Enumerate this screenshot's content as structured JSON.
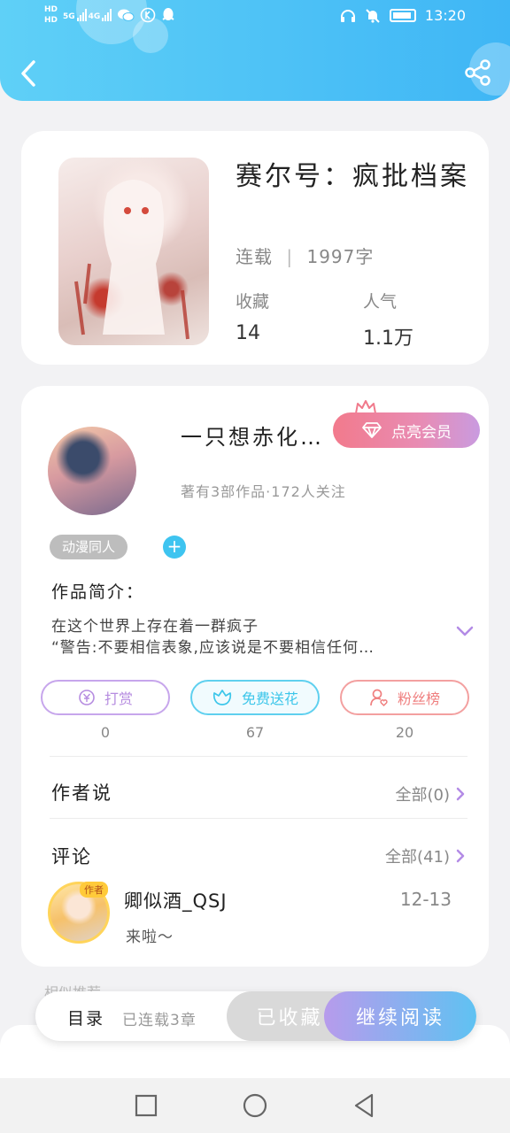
{
  "status_bar": {
    "network_labels": [
      "HD",
      "HD"
    ],
    "signal1_label": "5G",
    "signal2_label": "4G",
    "time": "13:20",
    "left_icons": [
      "hd-icon",
      "signal-icon",
      "wechat-icon",
      "k-icon",
      "qq-icon"
    ],
    "right_icons": [
      "headphones-icon",
      "mute-icon",
      "battery-icon"
    ]
  },
  "header": {
    "back_icon": "chevron-left-icon",
    "share_icon": "share-icon",
    "colors": {
      "gradient_start": "#5fd0f7",
      "gradient_end": "#3fb6f5"
    }
  },
  "book": {
    "title": "赛尔号：疯批档案",
    "status": "连载",
    "separator": "|",
    "word_count": "1997字",
    "favorites_label": "收藏",
    "favorites_value": "14",
    "popularity_label": "人气",
    "popularity_value": "1.1万"
  },
  "author": {
    "name": "一只想赤化…",
    "vip_label": "点亮会员",
    "stats": "著有3部作品·172人关注",
    "tag": "动漫同人",
    "tag_add": "+",
    "intro_label": "作品简介：",
    "intro_line1": "在这个世界上存在着一群疯子",
    "intro_line2": "“警告:不要相信表象,应该说是不要相信任何…"
  },
  "actions": [
    {
      "label": "打赏",
      "count": "0",
      "icon": "coin-icon",
      "color": "#b68ce0"
    },
    {
      "label": "免费送花",
      "count": "67",
      "icon": "flower-icon",
      "color": "#3cc6ea"
    },
    {
      "label": "粉丝榜",
      "count": "20",
      "icon": "fans-icon",
      "color": "#ef7f7f"
    }
  ],
  "author_says": {
    "title": "作者说",
    "link": "全部(0)"
  },
  "comments": {
    "title": "评论",
    "link": "全部(41)",
    "items": [
      {
        "badge": "作者",
        "name": "卿似酒_QSJ",
        "date": "12-13",
        "text": "来啦～"
      }
    ]
  },
  "bottom_bar": {
    "peek_text": "相似推荐",
    "toc_label": "目录",
    "toc_info": "已连载3章",
    "collected_label": "已收藏",
    "continue_label": "继续阅读"
  },
  "nav": {
    "icons": [
      "square-icon",
      "circle-icon",
      "triangle-back-icon"
    ]
  }
}
